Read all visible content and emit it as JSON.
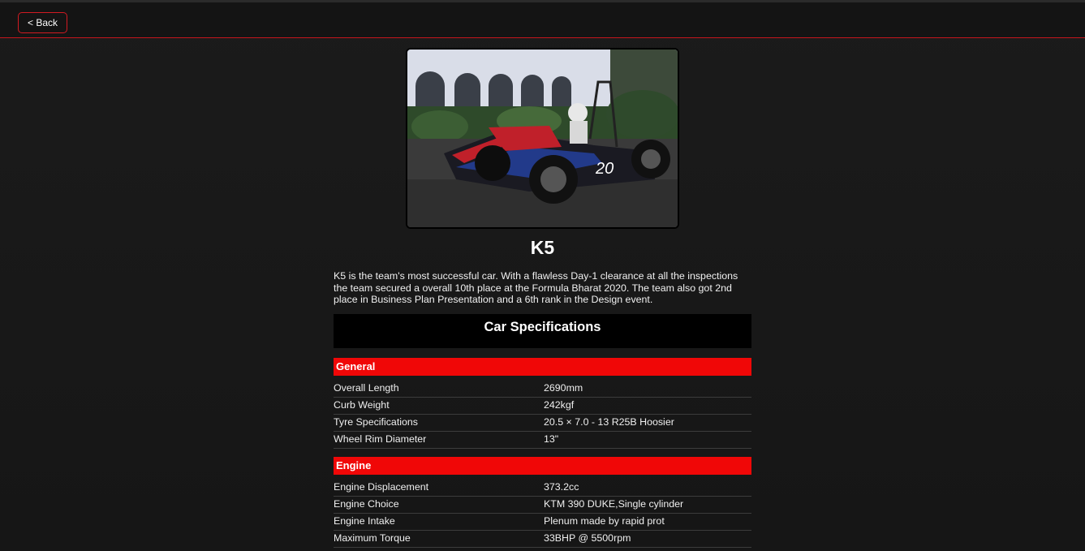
{
  "nav": {
    "back_label": "< Back"
  },
  "car": {
    "name": "K5",
    "image_alt": "K5 formula student race car",
    "description": "K5 is the team's most successful car. With a flawless Day-1 clearance at all the inspections the team secured a overall 10th place at the Formula Bharat 2020. The team also got 2nd place in Business Plan Presentation and a 6th rank in the Design event."
  },
  "specs": {
    "title": "Car Specifications",
    "sections": [
      {
        "title": "General",
        "rows": [
          {
            "key": "Overall Length",
            "value": "2690mm"
          },
          {
            "key": "Curb Weight",
            "value": "242kgf"
          },
          {
            "key": "Tyre Specifications",
            "value": "20.5 × 7.0 - 13 R25B Hoosier"
          },
          {
            "key": "Wheel Rim Diameter",
            "value": "13\""
          }
        ]
      },
      {
        "title": "Engine",
        "rows": [
          {
            "key": "Engine Displacement",
            "value": "373.2cc"
          },
          {
            "key": "Engine Choice",
            "value": "KTM 390 DUKE,Single cylinder"
          },
          {
            "key": "Engine Intake",
            "value": "Plenum made by rapid prot"
          },
          {
            "key": "Maximum Torque",
            "value": "33BHP @ 5500rpm"
          }
        ]
      }
    ]
  },
  "colors": {
    "accent": "#f00707",
    "background": "#1a1a1a",
    "spec_header_bg": "#000000"
  }
}
